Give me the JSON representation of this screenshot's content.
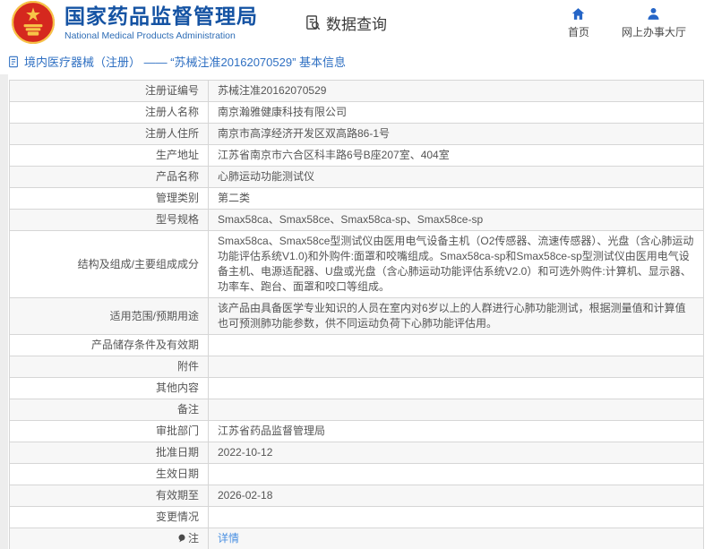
{
  "header": {
    "agency_name_cn": "国家药品监督管理局",
    "agency_name_en": "National Medical Products Administration",
    "data_query_label": "数据查询",
    "nav": [
      {
        "label": "首页",
        "icon": "home-icon"
      },
      {
        "label": "网上办事大厅",
        "icon": "person-icon"
      }
    ]
  },
  "breadcrumb": {
    "icon": "document-icon",
    "text": "境内医疗器械（注册） ——  “苏械注准20162070529” 基本信息"
  },
  "detail_table": {
    "rows": [
      {
        "label": "注册证编号",
        "value": "苏械注准20162070529"
      },
      {
        "label": "注册人名称",
        "value": "南京瀚雅健康科技有限公司"
      },
      {
        "label": "注册人住所",
        "value": "南京市高淳经济开发区双高路86-1号"
      },
      {
        "label": "生产地址",
        "value": "江苏省南京市六合区科丰路6号B座207室、404室"
      },
      {
        "label": "产品名称",
        "value": "心肺运动功能测试仪"
      },
      {
        "label": "管理类别",
        "value": "第二类"
      },
      {
        "label": "型号规格",
        "value": "Smax58ca、Smax58ce、Smax58ca-sp、Smax58ce-sp"
      },
      {
        "label": "结构及组成/主要组成成分",
        "value": "Smax58ca、Smax58ce型测试仪由医用电气设备主机（O2传感器、流速传感器）、光盘（含心肺运动功能评估系统V1.0)和外购件:面罩和咬嘴组成。Smax58ca-sp和Smax58ce-sp型测试仪由医用电气设备主机、电源适配器、U盘或光盘（含心肺运动功能评估系统V2.0）和可选外购件:计算机、显示器、功率车、跑台、面罩和咬口等组成。"
      },
      {
        "label": "适用范围/预期用途",
        "value": "该产品由具备医学专业知识的人员在室内对6岁以上的人群进行心肺功能测试，根据测量值和计算值也可预测肺功能参数，供不同运动负荷下心肺功能评估用。"
      },
      {
        "label": "产品储存条件及有效期",
        "value": ""
      },
      {
        "label": "附件",
        "value": ""
      },
      {
        "label": "其他内容",
        "value": ""
      },
      {
        "label": "备注",
        "value": ""
      },
      {
        "label": "审批部门",
        "value": "江苏省药品监督管理局"
      },
      {
        "label": "批准日期",
        "value": "2022-10-12"
      },
      {
        "label": "生效日期",
        "value": ""
      },
      {
        "label": "有效期至",
        "value": "2026-02-18"
      },
      {
        "label": "变更情况",
        "value": ""
      },
      {
        "label": "注",
        "value": "详情",
        "link": true,
        "icon": "speech-bubble-icon"
      }
    ]
  },
  "colors": {
    "brand_blue": "#1553a3",
    "nav_icon_blue": "#2565c7",
    "breadcrumb_blue": "#2e6fc2",
    "link_blue": "#4a90e2",
    "row_alt_bg": "#f7f7f7",
    "table_border": "#d6d6d6",
    "emblem_red": "#d5281e",
    "emblem_gold": "#f7c548"
  }
}
